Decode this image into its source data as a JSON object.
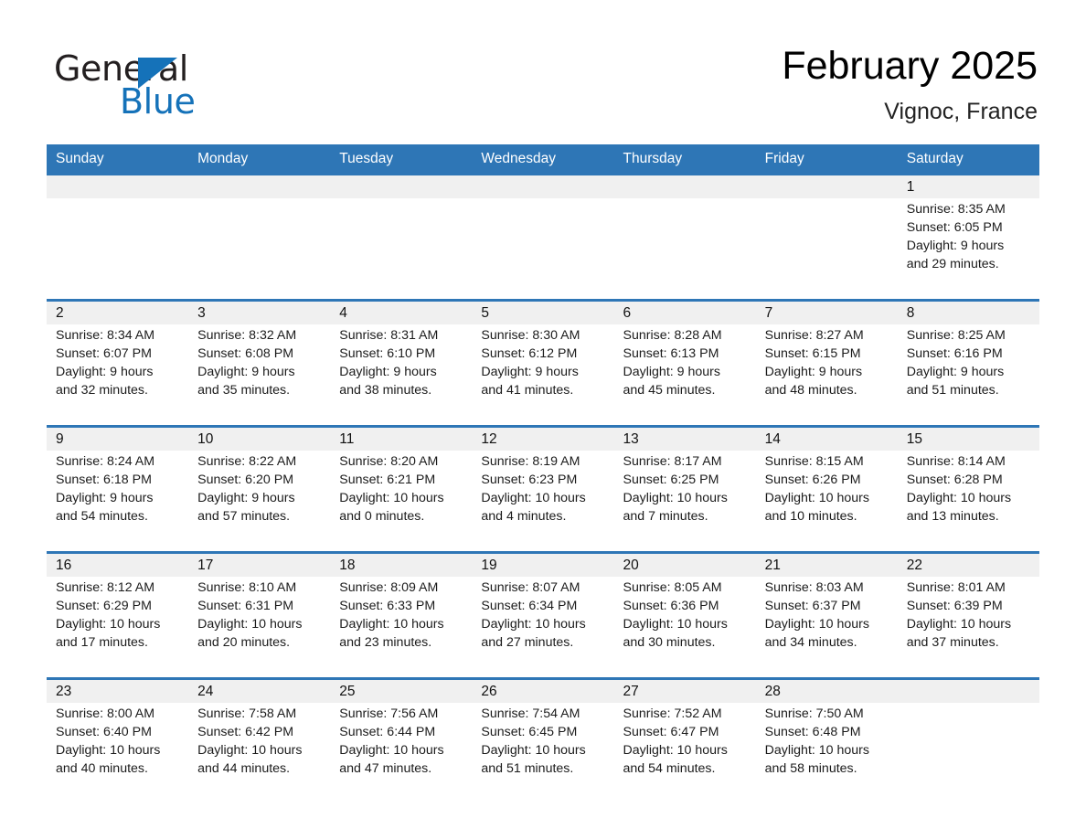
{
  "brand": {
    "name_top": "General",
    "name_bottom": "Blue",
    "accent_color": "#1572b9",
    "triangle_icon": "triangle-right-icon"
  },
  "header": {
    "month_title": "February 2025",
    "location": "Vignoc, France"
  },
  "theme": {
    "header_blue": "#2e76b6",
    "row_border_blue": "#2e76b6",
    "datestrip_gray": "#f0f0f0",
    "cell_white": "#ffffff",
    "text_color": "#1b1b1b"
  },
  "calendar": {
    "day_headers": [
      "Sunday",
      "Monday",
      "Tuesday",
      "Wednesday",
      "Thursday",
      "Friday",
      "Saturday"
    ],
    "weeks": [
      [
        {
          "day": "",
          "empty": true
        },
        {
          "day": "",
          "empty": true
        },
        {
          "day": "",
          "empty": true
        },
        {
          "day": "",
          "empty": true
        },
        {
          "day": "",
          "empty": true
        },
        {
          "day": "",
          "empty": true
        },
        {
          "day": "1",
          "sunrise": "Sunrise: 8:35 AM",
          "sunset": "Sunset: 6:05 PM",
          "daylight1": "Daylight: 9 hours",
          "daylight2": "and 29 minutes."
        }
      ],
      [
        {
          "day": "2",
          "sunrise": "Sunrise: 8:34 AM",
          "sunset": "Sunset: 6:07 PM",
          "daylight1": "Daylight: 9 hours",
          "daylight2": "and 32 minutes."
        },
        {
          "day": "3",
          "sunrise": "Sunrise: 8:32 AM",
          "sunset": "Sunset: 6:08 PM",
          "daylight1": "Daylight: 9 hours",
          "daylight2": "and 35 minutes."
        },
        {
          "day": "4",
          "sunrise": "Sunrise: 8:31 AM",
          "sunset": "Sunset: 6:10 PM",
          "daylight1": "Daylight: 9 hours",
          "daylight2": "and 38 minutes."
        },
        {
          "day": "5",
          "sunrise": "Sunrise: 8:30 AM",
          "sunset": "Sunset: 6:12 PM",
          "daylight1": "Daylight: 9 hours",
          "daylight2": "and 41 minutes."
        },
        {
          "day": "6",
          "sunrise": "Sunrise: 8:28 AM",
          "sunset": "Sunset: 6:13 PM",
          "daylight1": "Daylight: 9 hours",
          "daylight2": "and 45 minutes."
        },
        {
          "day": "7",
          "sunrise": "Sunrise: 8:27 AM",
          "sunset": "Sunset: 6:15 PM",
          "daylight1": "Daylight: 9 hours",
          "daylight2": "and 48 minutes."
        },
        {
          "day": "8",
          "sunrise": "Sunrise: 8:25 AM",
          "sunset": "Sunset: 6:16 PM",
          "daylight1": "Daylight: 9 hours",
          "daylight2": "and 51 minutes."
        }
      ],
      [
        {
          "day": "9",
          "sunrise": "Sunrise: 8:24 AM",
          "sunset": "Sunset: 6:18 PM",
          "daylight1": "Daylight: 9 hours",
          "daylight2": "and 54 minutes."
        },
        {
          "day": "10",
          "sunrise": "Sunrise: 8:22 AM",
          "sunset": "Sunset: 6:20 PM",
          "daylight1": "Daylight: 9 hours",
          "daylight2": "and 57 minutes."
        },
        {
          "day": "11",
          "sunrise": "Sunrise: 8:20 AM",
          "sunset": "Sunset: 6:21 PM",
          "daylight1": "Daylight: 10 hours",
          "daylight2": "and 0 minutes."
        },
        {
          "day": "12",
          "sunrise": "Sunrise: 8:19 AM",
          "sunset": "Sunset: 6:23 PM",
          "daylight1": "Daylight: 10 hours",
          "daylight2": "and 4 minutes."
        },
        {
          "day": "13",
          "sunrise": "Sunrise: 8:17 AM",
          "sunset": "Sunset: 6:25 PM",
          "daylight1": "Daylight: 10 hours",
          "daylight2": "and 7 minutes."
        },
        {
          "day": "14",
          "sunrise": "Sunrise: 8:15 AM",
          "sunset": "Sunset: 6:26 PM",
          "daylight1": "Daylight: 10 hours",
          "daylight2": "and 10 minutes."
        },
        {
          "day": "15",
          "sunrise": "Sunrise: 8:14 AM",
          "sunset": "Sunset: 6:28 PM",
          "daylight1": "Daylight: 10 hours",
          "daylight2": "and 13 minutes."
        }
      ],
      [
        {
          "day": "16",
          "sunrise": "Sunrise: 8:12 AM",
          "sunset": "Sunset: 6:29 PM",
          "daylight1": "Daylight: 10 hours",
          "daylight2": "and 17 minutes."
        },
        {
          "day": "17",
          "sunrise": "Sunrise: 8:10 AM",
          "sunset": "Sunset: 6:31 PM",
          "daylight1": "Daylight: 10 hours",
          "daylight2": "and 20 minutes."
        },
        {
          "day": "18",
          "sunrise": "Sunrise: 8:09 AM",
          "sunset": "Sunset: 6:33 PM",
          "daylight1": "Daylight: 10 hours",
          "daylight2": "and 23 minutes."
        },
        {
          "day": "19",
          "sunrise": "Sunrise: 8:07 AM",
          "sunset": "Sunset: 6:34 PM",
          "daylight1": "Daylight: 10 hours",
          "daylight2": "and 27 minutes."
        },
        {
          "day": "20",
          "sunrise": "Sunrise: 8:05 AM",
          "sunset": "Sunset: 6:36 PM",
          "daylight1": "Daylight: 10 hours",
          "daylight2": "and 30 minutes."
        },
        {
          "day": "21",
          "sunrise": "Sunrise: 8:03 AM",
          "sunset": "Sunset: 6:37 PM",
          "daylight1": "Daylight: 10 hours",
          "daylight2": "and 34 minutes."
        },
        {
          "day": "22",
          "sunrise": "Sunrise: 8:01 AM",
          "sunset": "Sunset: 6:39 PM",
          "daylight1": "Daylight: 10 hours",
          "daylight2": "and 37 minutes."
        }
      ],
      [
        {
          "day": "23",
          "sunrise": "Sunrise: 8:00 AM",
          "sunset": "Sunset: 6:40 PM",
          "daylight1": "Daylight: 10 hours",
          "daylight2": "and 40 minutes."
        },
        {
          "day": "24",
          "sunrise": "Sunrise: 7:58 AM",
          "sunset": "Sunset: 6:42 PM",
          "daylight1": "Daylight: 10 hours",
          "daylight2": "and 44 minutes."
        },
        {
          "day": "25",
          "sunrise": "Sunrise: 7:56 AM",
          "sunset": "Sunset: 6:44 PM",
          "daylight1": "Daylight: 10 hours",
          "daylight2": "and 47 minutes."
        },
        {
          "day": "26",
          "sunrise": "Sunrise: 7:54 AM",
          "sunset": "Sunset: 6:45 PM",
          "daylight1": "Daylight: 10 hours",
          "daylight2": "and 51 minutes."
        },
        {
          "day": "27",
          "sunrise": "Sunrise: 7:52 AM",
          "sunset": "Sunset: 6:47 PM",
          "daylight1": "Daylight: 10 hours",
          "daylight2": "and 54 minutes."
        },
        {
          "day": "28",
          "sunrise": "Sunrise: 7:50 AM",
          "sunset": "Sunset: 6:48 PM",
          "daylight1": "Daylight: 10 hours",
          "daylight2": "and 58 minutes."
        },
        {
          "day": "",
          "empty": true
        }
      ]
    ]
  }
}
